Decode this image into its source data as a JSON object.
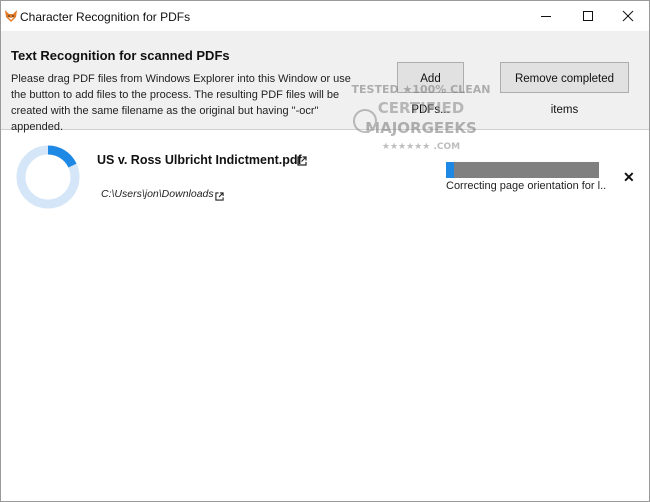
{
  "window": {
    "title": "Character Recognition for PDFs"
  },
  "header": {
    "title": "Text Recognition for scanned PDFs",
    "description": "Please drag PDF files from Windows Explorer into this Window or use the button to add files to the process. The resulting PDF files will be created with the same filename as the original but having \"-ocr\" appended.",
    "add_button": "Add PDFs...",
    "remove_button": "Remove completed items"
  },
  "watermark": {
    "line1": "TESTED ★100% CLEAN",
    "line2": "CERTIFIED",
    "line3": "MAJORGEEKS",
    "line4": "★★★★★★ .COM"
  },
  "jobs": [
    {
      "filename": "US v. Ross Ulbricht Indictment.pdf",
      "path": "C:\\Users\\jon\\Downloads",
      "status": "Correcting page orientation for l...",
      "progress": 0.05,
      "ring_progress": 0.18
    }
  ],
  "colors": {
    "accent": "#1e88e5",
    "ring_track": "#d4e6f8",
    "progress_track": "#808080",
    "header_bg": "#f0f0f0"
  },
  "icons": {
    "app": "fox-icon",
    "minimize": "minimize-icon",
    "maximize": "maximize-icon",
    "close": "close-icon",
    "open_external": "external-link-icon",
    "remove_job": "close-x-icon"
  }
}
